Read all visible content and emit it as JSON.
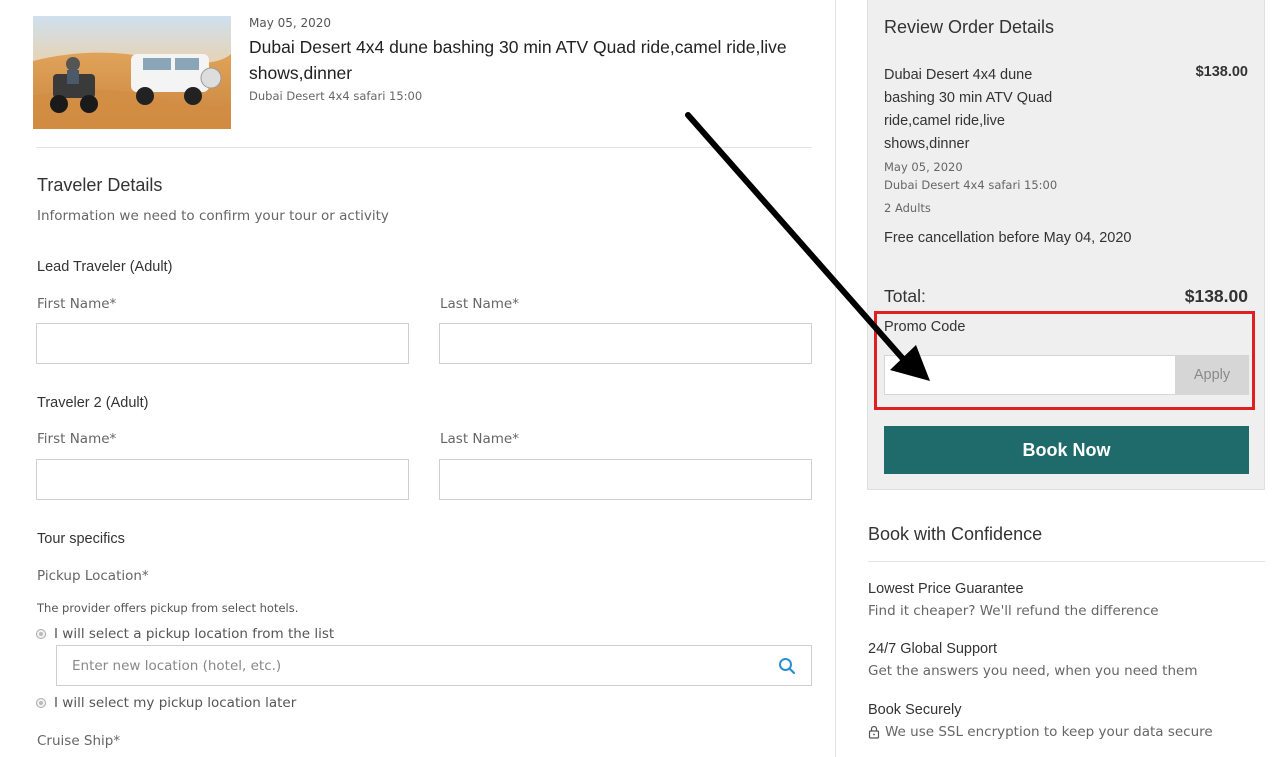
{
  "tour": {
    "date": "May 05, 2020",
    "title": "Dubai Desert 4x4 dune bashing 30 min ATV Quad ride,camel ride,live shows,dinner",
    "option": "Dubai Desert 4x4 safari 15:00"
  },
  "traveler_details": {
    "title": "Traveler Details",
    "subtitle": "Information we need to confirm your tour or activity",
    "lead_label": "Lead Traveler (Adult)",
    "traveler2_label": "Traveler 2 (Adult)",
    "first_name_label": "First Name*",
    "last_name_label": "Last Name*"
  },
  "tour_specifics": {
    "title": "Tour specifics",
    "pickup_label": "Pickup Location*",
    "pickup_note": "The provider offers pickup from select hotels.",
    "option_select": "I will select a pickup location from the list",
    "location_placeholder": "Enter new location (hotel, etc.)",
    "option_later": "I will select my pickup location later",
    "cruise_label": "Cruise Ship*"
  },
  "review": {
    "title": "Review Order Details",
    "item_name": "Dubai Desert 4x4 dune bashing 30 min ATV Quad ride,camel ride,live shows,dinner",
    "item_price": "$138.00",
    "date": "May 05, 2020",
    "option": "Dubai Desert 4x4 safari 15:00",
    "travelers": "2 Adults",
    "cancellation": "Free cancellation before May 04, 2020",
    "total_label": "Total:",
    "total_value": "$138.00",
    "promo_label": "Promo Code",
    "promo_value": "",
    "apply_label": "Apply",
    "book_label": "Book Now"
  },
  "confidence": {
    "title": "Book with Confidence",
    "items": [
      {
        "title": "Lowest Price Guarantee",
        "desc": "Find it cheaper? We'll refund the difference"
      },
      {
        "title": "24/7 Global Support",
        "desc": "Get the answers you need, when you need them"
      },
      {
        "title": "Book Securely",
        "desc": "We use SSL encryption to keep your data secure"
      }
    ]
  },
  "colors": {
    "accent": "#1f6b6b",
    "highlight": "#e02020"
  },
  "icons": [
    "search-icon",
    "lock-icon",
    "pointer-arrow-icon"
  ]
}
